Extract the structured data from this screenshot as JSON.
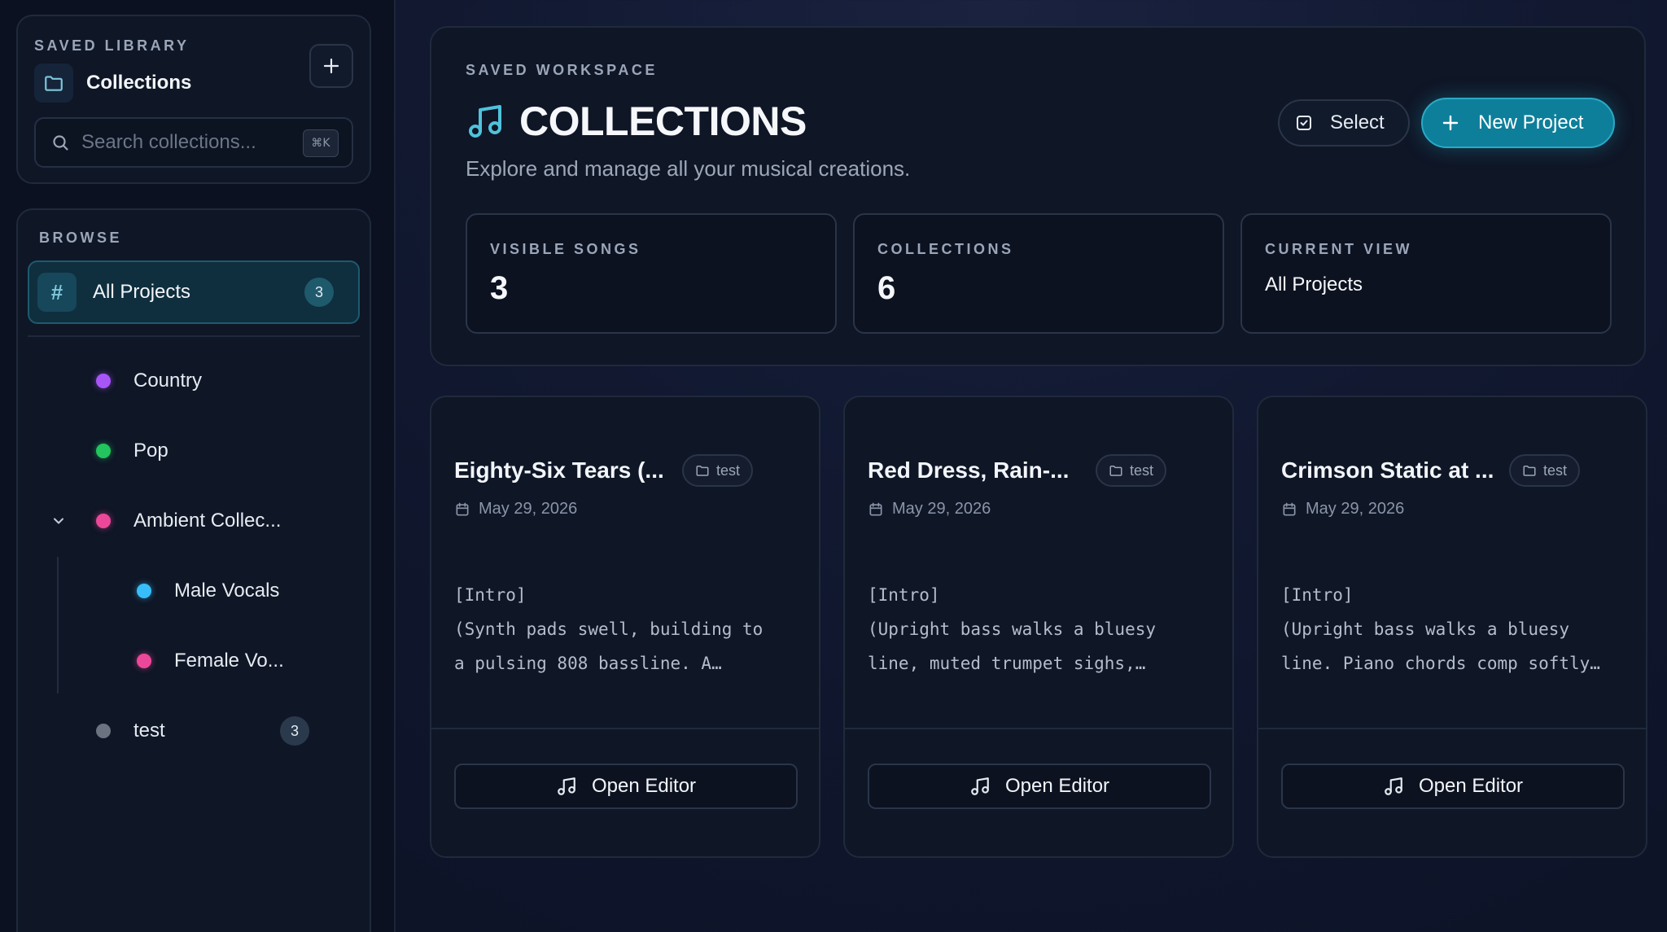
{
  "sidebar": {
    "library": {
      "eyebrow": "SAVED LIBRARY",
      "title": "Collections",
      "search_placeholder": "Search collections...",
      "shortcut": "⌘K"
    },
    "browse": {
      "eyebrow": "BROWSE",
      "all_projects": {
        "label": "All Projects",
        "count": "3"
      },
      "items": [
        {
          "label": "Country",
          "color": "#a855f7"
        },
        {
          "label": "Pop",
          "color": "#22c55e"
        },
        {
          "label": "Ambient Collec...",
          "color": "#ec4899"
        },
        {
          "label": "Male Vocals",
          "color": "#38bdf8"
        },
        {
          "label": "Female Vo...",
          "color": "#ec4899"
        },
        {
          "label": "test",
          "color": "#6b7280",
          "count": "3"
        }
      ]
    }
  },
  "workspace": {
    "eyebrow": "SAVED WORKSPACE",
    "title": "COLLECTIONS",
    "subtitle": "Explore and manage all your musical creations.",
    "select_label": "Select",
    "new_project_label": "New Project",
    "stats": [
      {
        "label": "VISIBLE SONGS",
        "value": "3"
      },
      {
        "label": "COLLECTIONS",
        "value": "6"
      },
      {
        "label": "CURRENT VIEW",
        "value": "All Projects"
      }
    ]
  },
  "cards": [
    {
      "title": "Eighty-Six Tears (...",
      "tag": "test",
      "date": "May 29, 2026",
      "lyrics": "[Intro]\n(Synth pads swell, building to\na pulsing 808 bassline. A…",
      "button": "Open Editor"
    },
    {
      "title": "Red Dress, Rain-...",
      "tag": "test",
      "date": "May 29, 2026",
      "lyrics": "[Intro]\n(Upright bass walks a bluesy\nline, muted trumpet sighs,…",
      "button": "Open Editor"
    },
    {
      "title": "Crimson Static at ...",
      "tag": "test",
      "date": "May 29, 2026",
      "lyrics": "[Intro]\n(Upright bass walks a bluesy\nline. Piano chords comp softly…",
      "button": "Open Editor"
    }
  ],
  "colors": {
    "accent": "#0e7f9a",
    "accent_border": "#2aa9c6",
    "music_icon": "#4fc3dc"
  }
}
